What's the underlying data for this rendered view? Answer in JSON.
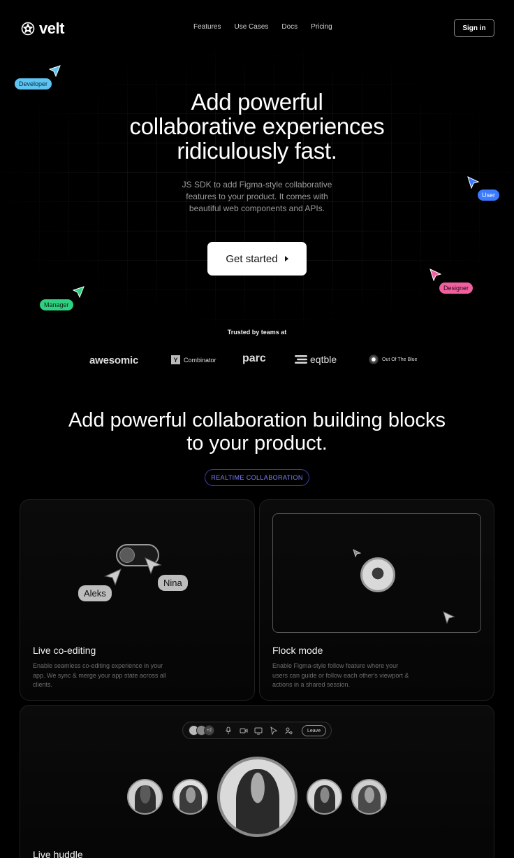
{
  "brand": {
    "name": "velt"
  },
  "nav": {
    "items": [
      "Features",
      "Use Cases",
      "Docs",
      "Pricing"
    ],
    "signin": "Sign in"
  },
  "hero": {
    "title_lines": [
      "Add powerful",
      "collaborative experiences",
      "ridiculously fast."
    ],
    "subtitle_lines": [
      "JS SDK to add Figma-style collaborative",
      "features to your product. It comes with",
      "beautiful web components and APIs."
    ],
    "cta": "Get started"
  },
  "cursors": {
    "developer": {
      "label": "Developer",
      "color": "#5ec4f2"
    },
    "user": {
      "label": "User",
      "color": "#3a7bff"
    },
    "designer": {
      "label": "Designer",
      "color": "#f0609e"
    },
    "manager": {
      "label": "Manager",
      "color": "#2fd07f"
    }
  },
  "trusted": {
    "label": "Trusted by teams at",
    "logos": [
      "awesomic",
      "Combinator",
      "parc",
      "eqtble",
      "Out Of The Blue"
    ],
    "ycombinator_mark": "Y"
  },
  "section2": {
    "title_lines": [
      "Add powerful collaboration building blocks",
      "to your product."
    ],
    "pill": "REALTIME COLLABORATION"
  },
  "cards": {
    "live_coediting": {
      "title": "Live co-editing",
      "desc_lines": [
        "Enable seamless co-editing experience in your",
        "app. We sync & merge your app state across all",
        "clients."
      ],
      "names": [
        "Aleks",
        "Nina"
      ]
    },
    "flock": {
      "title": "Flock mode",
      "desc_lines": [
        "Enable Figma-style follow feature where your",
        "users can guide or follow each other's viewport &",
        "actions in a shared session."
      ]
    },
    "huddle": {
      "title": "Live huddle",
      "extra_count": "+2",
      "leave": "Leave"
    }
  }
}
